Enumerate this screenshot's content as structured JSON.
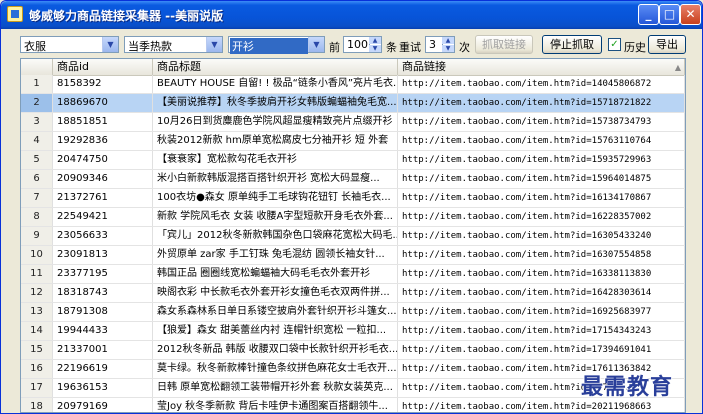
{
  "window": {
    "title": "够威够力商品链接采集器 --美丽说版",
    "minimize_glyph": "_",
    "maximize_glyph": "□",
    "close_glyph": "✕"
  },
  "toolbar": {
    "category_select": "衣服",
    "season_select": "当季热款",
    "style_select": "开衫",
    "before_label": "前",
    "count_value": "100",
    "items_label": "条",
    "retry_label": "重试",
    "retry_value": "3",
    "times_label": "次",
    "fetch_button": "抓取链接",
    "stop_button": "停止抓取",
    "history_label": "历史",
    "history_checked": true,
    "export_button": "导出"
  },
  "table": {
    "headers": [
      "",
      "商品id",
      "商品标题",
      "商品链接"
    ],
    "selected_row": 1,
    "rows": [
      {
        "n": "1",
        "id": "8158392",
        "title": "BEAUTY HOUSE 自留! ! 极品“链条小香风”亮片毛衣...",
        "link": "http://item.taobao.com/item.htm?id=14045806872"
      },
      {
        "n": "2",
        "id": "18869670",
        "title": "【美丽说推荐】秋冬季披肩开衫女韩版蝙蝠袖兔毛宽...",
        "link": "http://item.taobao.com/item.htm?id=15718721822"
      },
      {
        "n": "3",
        "id": "18851851",
        "title": "10月26日到货麋鹿色学院风超显瘦精致亮片点缀开衫",
        "link": "http://item.taobao.com/item.htm?id=15738734793"
      },
      {
        "n": "4",
        "id": "19292836",
        "title": "秋装2012新款 hm原单宽松腐皮七分袖开衫 短 外套",
        "link": "http://item.taobao.com/item.htm?id=15763110764"
      },
      {
        "n": "5",
        "id": "20474750",
        "title": "【衰衰家】宽松款勾花毛衣开衫",
        "link": "http://item.taobao.com/item.htm?id=15935729963"
      },
      {
        "n": "6",
        "id": "20909346",
        "title": "米小白新款韩版混搭百搭针织开衫 宽松大码显瘦...",
        "link": "http://item.taobao.com/item.htm?id=15964014875"
      },
      {
        "n": "7",
        "id": "21372761",
        "title": "100衣坊●森女 原单纯手工毛球钩花钮钉 长袖毛衣...",
        "link": "http://item.taobao.com/item.htm?id=16134170867"
      },
      {
        "n": "8",
        "id": "22549421",
        "title": "新款 学院风毛衣 女装 收腰A字型短款开身毛衣外套...",
        "link": "http://item.taobao.com/item.htm?id=16228357002"
      },
      {
        "n": "9",
        "id": "23056633",
        "title": "「宾儿」2012秋冬新款韩国杂色口袋麻花宽松大码毛...",
        "link": "http://item.taobao.com/item.htm?id=16305433240"
      },
      {
        "n": "10",
        "id": "23091813",
        "title": "外贸原单 zar家 手工钉珠 兔毛混纺 圆领长袖女针...",
        "link": "http://item.taobao.com/item.htm?id=16307554858"
      },
      {
        "n": "11",
        "id": "23377195",
        "title": "韩国正品 圈圈线宽松蝙蝠袖大码毛毛衣外套开衫",
        "link": "http://item.taobao.com/item.htm?id=16338113830"
      },
      {
        "n": "12",
        "id": "18318743",
        "title": "映阁衣彩 中长款毛衣外套开衫女撞色毛衣双两件拼...",
        "link": "http://item.taobao.com/item.htm?id=16428303614"
      },
      {
        "n": "13",
        "id": "18791308",
        "title": "森女系森林系日单日系镂空披肩外套针织开衫斗篷女...",
        "link": "http://item.taobao.com/item.htm?id=16925683977"
      },
      {
        "n": "14",
        "id": "19944433",
        "title": "【狼爱】森女 甜美蕾丝内衬 连帽针织宽松 一粒扣...",
        "link": "http://item.taobao.com/item.htm?id=17154343243"
      },
      {
        "n": "15",
        "id": "21337001",
        "title": "2012秋冬新品 韩版 收腰双口袋中长款针织开衫毛衣...",
        "link": "http://item.taobao.com/item.htm?id=17394691041"
      },
      {
        "n": "16",
        "id": "22196619",
        "title": "莫卡绿。秋冬新款棒针撞色条纹拼色麻花女士毛衣开...",
        "link": "http://item.taobao.com/item.htm?id=17611363842"
      },
      {
        "n": "17",
        "id": "19636153",
        "title": "日韩 原单宽松翻领工装带帽开衫外套 秋款女装英克...",
        "link": "http://item.taobao.com/item.htm?id=17774..."
      },
      {
        "n": "18",
        "id": "20979169",
        "title": "莹Joy 秋冬季新款 背后卡哇伊卡通图案百搭翻领牛...",
        "link": "http://item.taobao.com/item.htm?id=20211968663"
      }
    ]
  },
  "watermark": "最需教育"
}
